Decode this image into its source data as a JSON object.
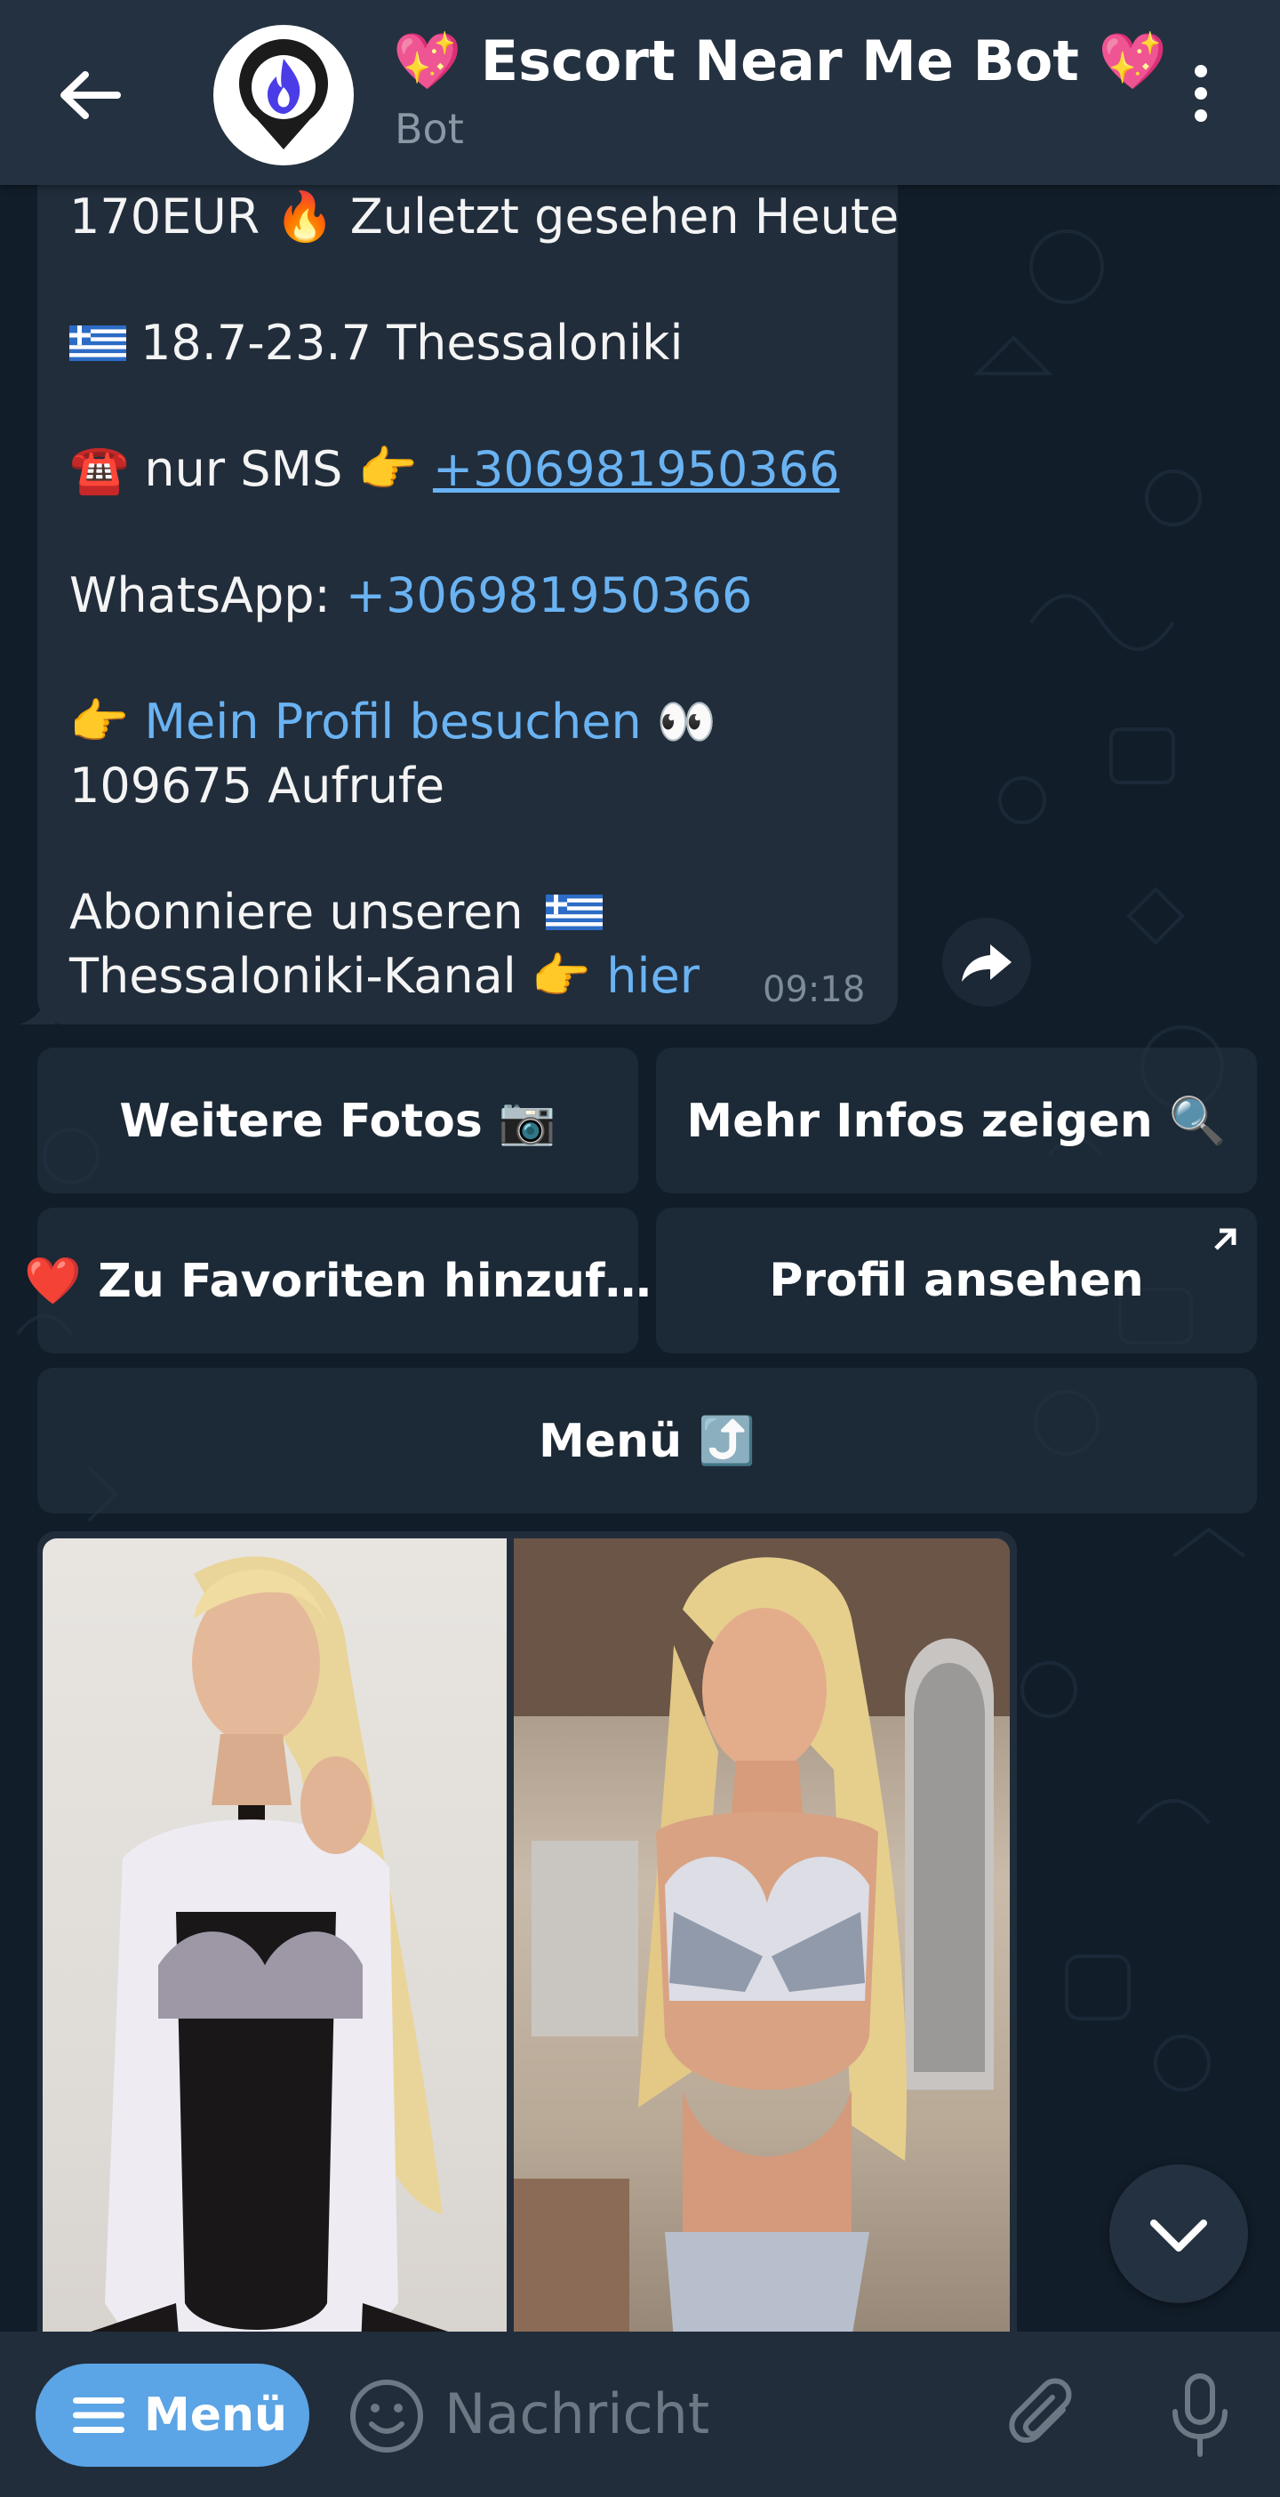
{
  "header": {
    "title": "💖 Escort Near Me Bot 💖",
    "subtitle": "Bot",
    "back_icon": "arrow-left-icon",
    "more_icon": "more-vertical-icon",
    "avatar_icon": "flame-pin-icon"
  },
  "message": {
    "line1": "170EUR 🔥 Zuletzt gesehen Heute",
    "line2_text": "18.7-23.7 Thessaloniki",
    "line3_prefix": "☎️ nur SMS 👉 ",
    "line3_phone": "+306981950366",
    "line4_prefix": "WhatsApp: ",
    "line4_phone": "+306981950366",
    "line5_prefix": "👉 ",
    "line5_link": "Mein Profil besuchen",
    "line5_suffix": " 👀",
    "line6": "109675 Aufrufe",
    "line7_text": "Abonniere unseren",
    "line8_prefix": "Thessaloniki-Kanal 👉 ",
    "line8_link": "hier",
    "time": "09:18"
  },
  "keyboard": {
    "more_photos": "Weitere Fotos 📷",
    "more_info": "Mehr Infos zeigen 🔍",
    "add_favorites": "❤️ Zu Favoriten hinzuf…",
    "view_profile": "Profil ansehen",
    "menu": "Menü ⤴️"
  },
  "input": {
    "menu_label": "Menü",
    "placeholder": "Nachricht"
  },
  "colors": {
    "header_bg": "#243140",
    "bubble_bg": "#212d3b",
    "link": "#6ab3f3",
    "menu_button": "#5ba4e5"
  }
}
